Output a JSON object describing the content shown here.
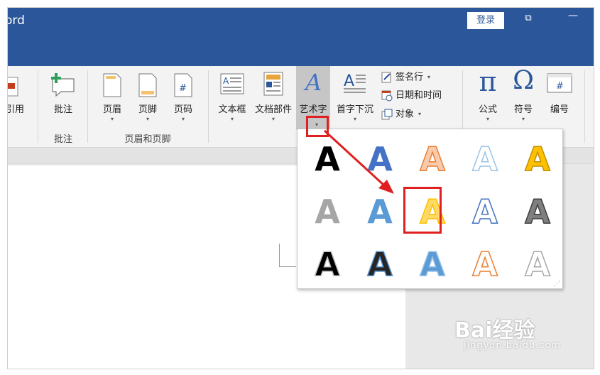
{
  "titlebar": {
    "app_title": "ord",
    "login_label": "登录",
    "restore_symbol": "⧉",
    "minimize_symbol": "—"
  },
  "ribbon": {
    "buttons": {
      "reference": {
        "label": "引用"
      },
      "comment": {
        "label": "批注"
      },
      "header": {
        "label": "页眉",
        "arrow": "▾"
      },
      "footer": {
        "label": "页脚",
        "arrow": "▾"
      },
      "page_number": {
        "label": "页码",
        "arrow": "▾"
      },
      "textbox": {
        "label": "文本框",
        "arrow": "▾"
      },
      "quick_parts": {
        "label": "文档部件",
        "arrow": "▾"
      },
      "wordart": {
        "label": "艺术字",
        "arrow": "▾"
      },
      "dropcap": {
        "label": "首字下沉",
        "arrow": "▾"
      },
      "equation": {
        "label": "公式",
        "arrow": "▾"
      },
      "symbol": {
        "label": "符号",
        "arrow": "▾"
      },
      "number": {
        "label": "编号"
      }
    },
    "small_commands": {
      "signature": {
        "label": "签名行",
        "arrow": "▾"
      },
      "datetime": {
        "label": "日期和时间"
      },
      "object": {
        "label": "对象",
        "arrow": "▾"
      }
    },
    "group_labels": {
      "comments": "批注",
      "header_footer": "页眉和页脚"
    },
    "icon_glyphs": {
      "pi": "π",
      "omega": "Ω",
      "hash": "#",
      "wordart_a": "A"
    }
  },
  "wordart_gallery": {
    "glyph": "A",
    "styles": [
      {
        "fill": "#000000",
        "stroke": "none"
      },
      {
        "fill": "#4472c4",
        "stroke": "none"
      },
      {
        "fill": "#f8cbad",
        "stroke": "#ed7d31"
      },
      {
        "fill": "#ffffff",
        "stroke": "#9dc3e6"
      },
      {
        "fill": "#ffc000",
        "stroke": "#bf9000"
      },
      {
        "fill": "#a6a6a6",
        "stroke": "none"
      },
      {
        "fill": "#5b9bd5",
        "stroke": "none"
      },
      {
        "fill": "#ffd966",
        "stroke": "#ffc000"
      },
      {
        "fill": "#ffffff",
        "stroke": "#4472c4"
      },
      {
        "fill": "#7f7f7f",
        "stroke": "#404040"
      },
      {
        "fill": "#000000",
        "stroke": "#bfbfbf"
      },
      {
        "fill": "#262626",
        "stroke": "#5b9bd5"
      },
      {
        "fill": "#5b9bd5",
        "stroke": "#9dc3e6"
      },
      {
        "fill": "#ffffff",
        "stroke": "#ed7d31"
      },
      {
        "fill": "#ffffff",
        "stroke": "#a6a6a6"
      }
    ],
    "resize_grip": "⋰"
  },
  "watermark": {
    "brand": "Bai经验",
    "url": "jingyan.baidu.com"
  },
  "colors": {
    "titlebar": "#2b579a",
    "highlight": "#e02020",
    "ribbon_bg": "#f3f3f3"
  }
}
